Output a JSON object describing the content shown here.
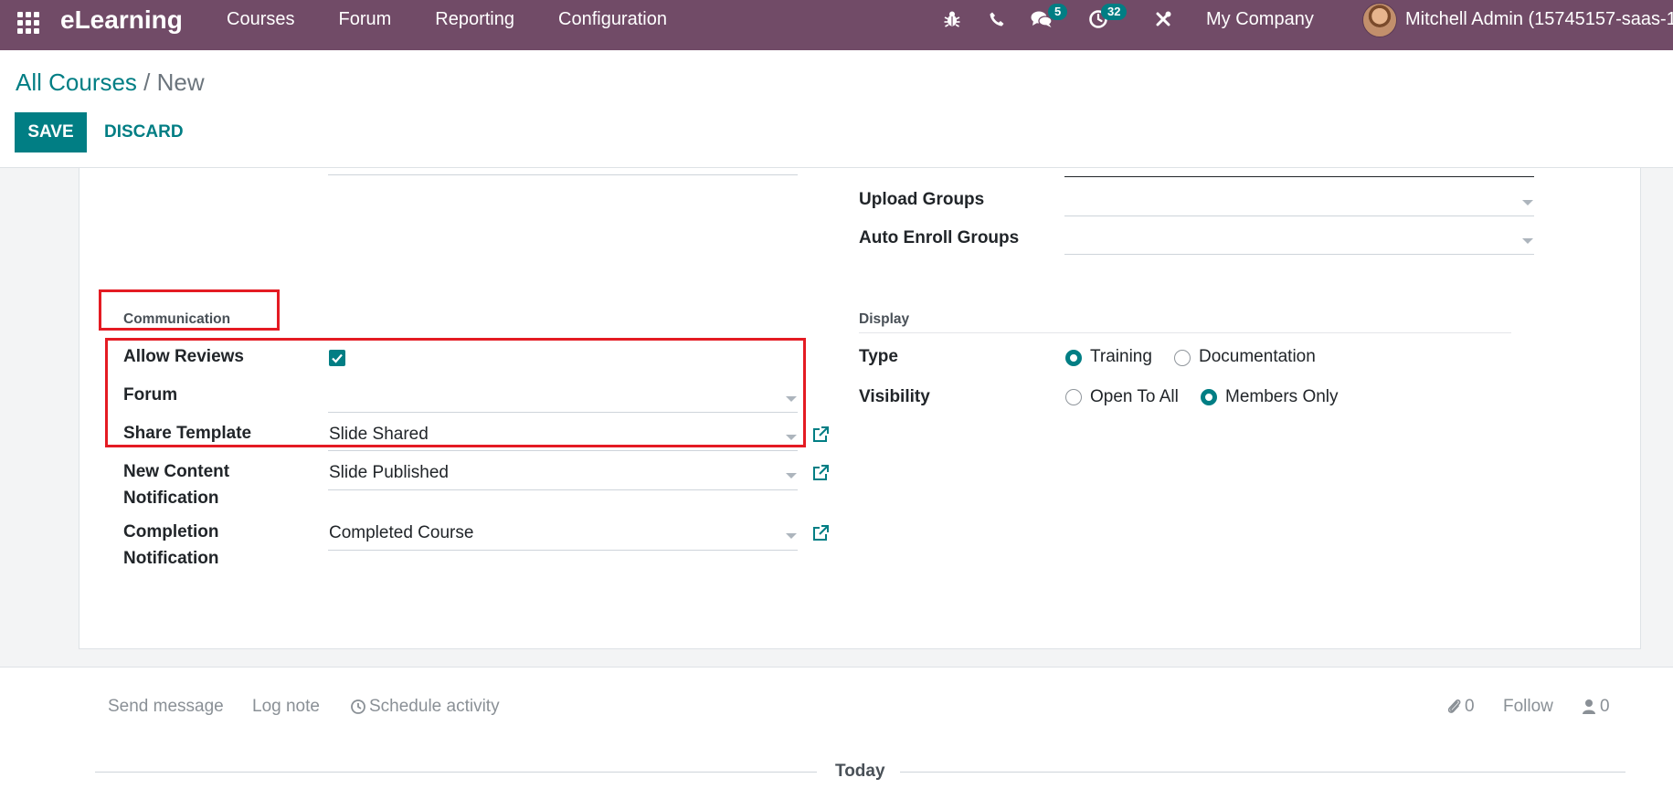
{
  "navbar": {
    "brand": "eLearning",
    "menu": [
      "Courses",
      "Forum",
      "Reporting",
      "Configuration"
    ],
    "messages_count": "5",
    "activities_count": "32",
    "company": "My Company",
    "user": "Mitchell Admin (15745157-saas-1",
    "color": "#714B67"
  },
  "breadcrumb": {
    "parent": "All Courses",
    "separator": "/",
    "current": "New"
  },
  "buttons": {
    "save": "SAVE",
    "discard": "DISCARD"
  },
  "form": {
    "upload_groups_label": "Upload Groups",
    "auto_enroll_groups_label": "Auto Enroll Groups",
    "communication_title": "Communication",
    "allow_reviews_label": "Allow Reviews",
    "allow_reviews_checked": true,
    "forum_label": "Forum",
    "forum_value": "",
    "share_template_label": "Share Template",
    "share_template_value": "Slide Shared",
    "new_content_label_1": "New Content",
    "new_content_label_2": "Notification",
    "new_content_value": "Slide Published",
    "completion_label_1": "Completion",
    "completion_label_2": "Notification",
    "completion_value": "Completed Course",
    "display_title": "Display",
    "type_label": "Type",
    "type_options": [
      "Training",
      "Documentation"
    ],
    "type_selected": "Training",
    "visibility_label": "Visibility",
    "visibility_options": [
      "Open To All",
      "Members Only"
    ],
    "visibility_selected": "Members Only"
  },
  "chatter": {
    "send_message": "Send message",
    "log_note": "Log note",
    "schedule_activity": "Schedule activity",
    "attachments_count": "0",
    "follow": "Follow",
    "followers_count": "0",
    "today": "Today"
  },
  "colors": {
    "primary": "#017E84",
    "highlight": "#e41b23"
  }
}
